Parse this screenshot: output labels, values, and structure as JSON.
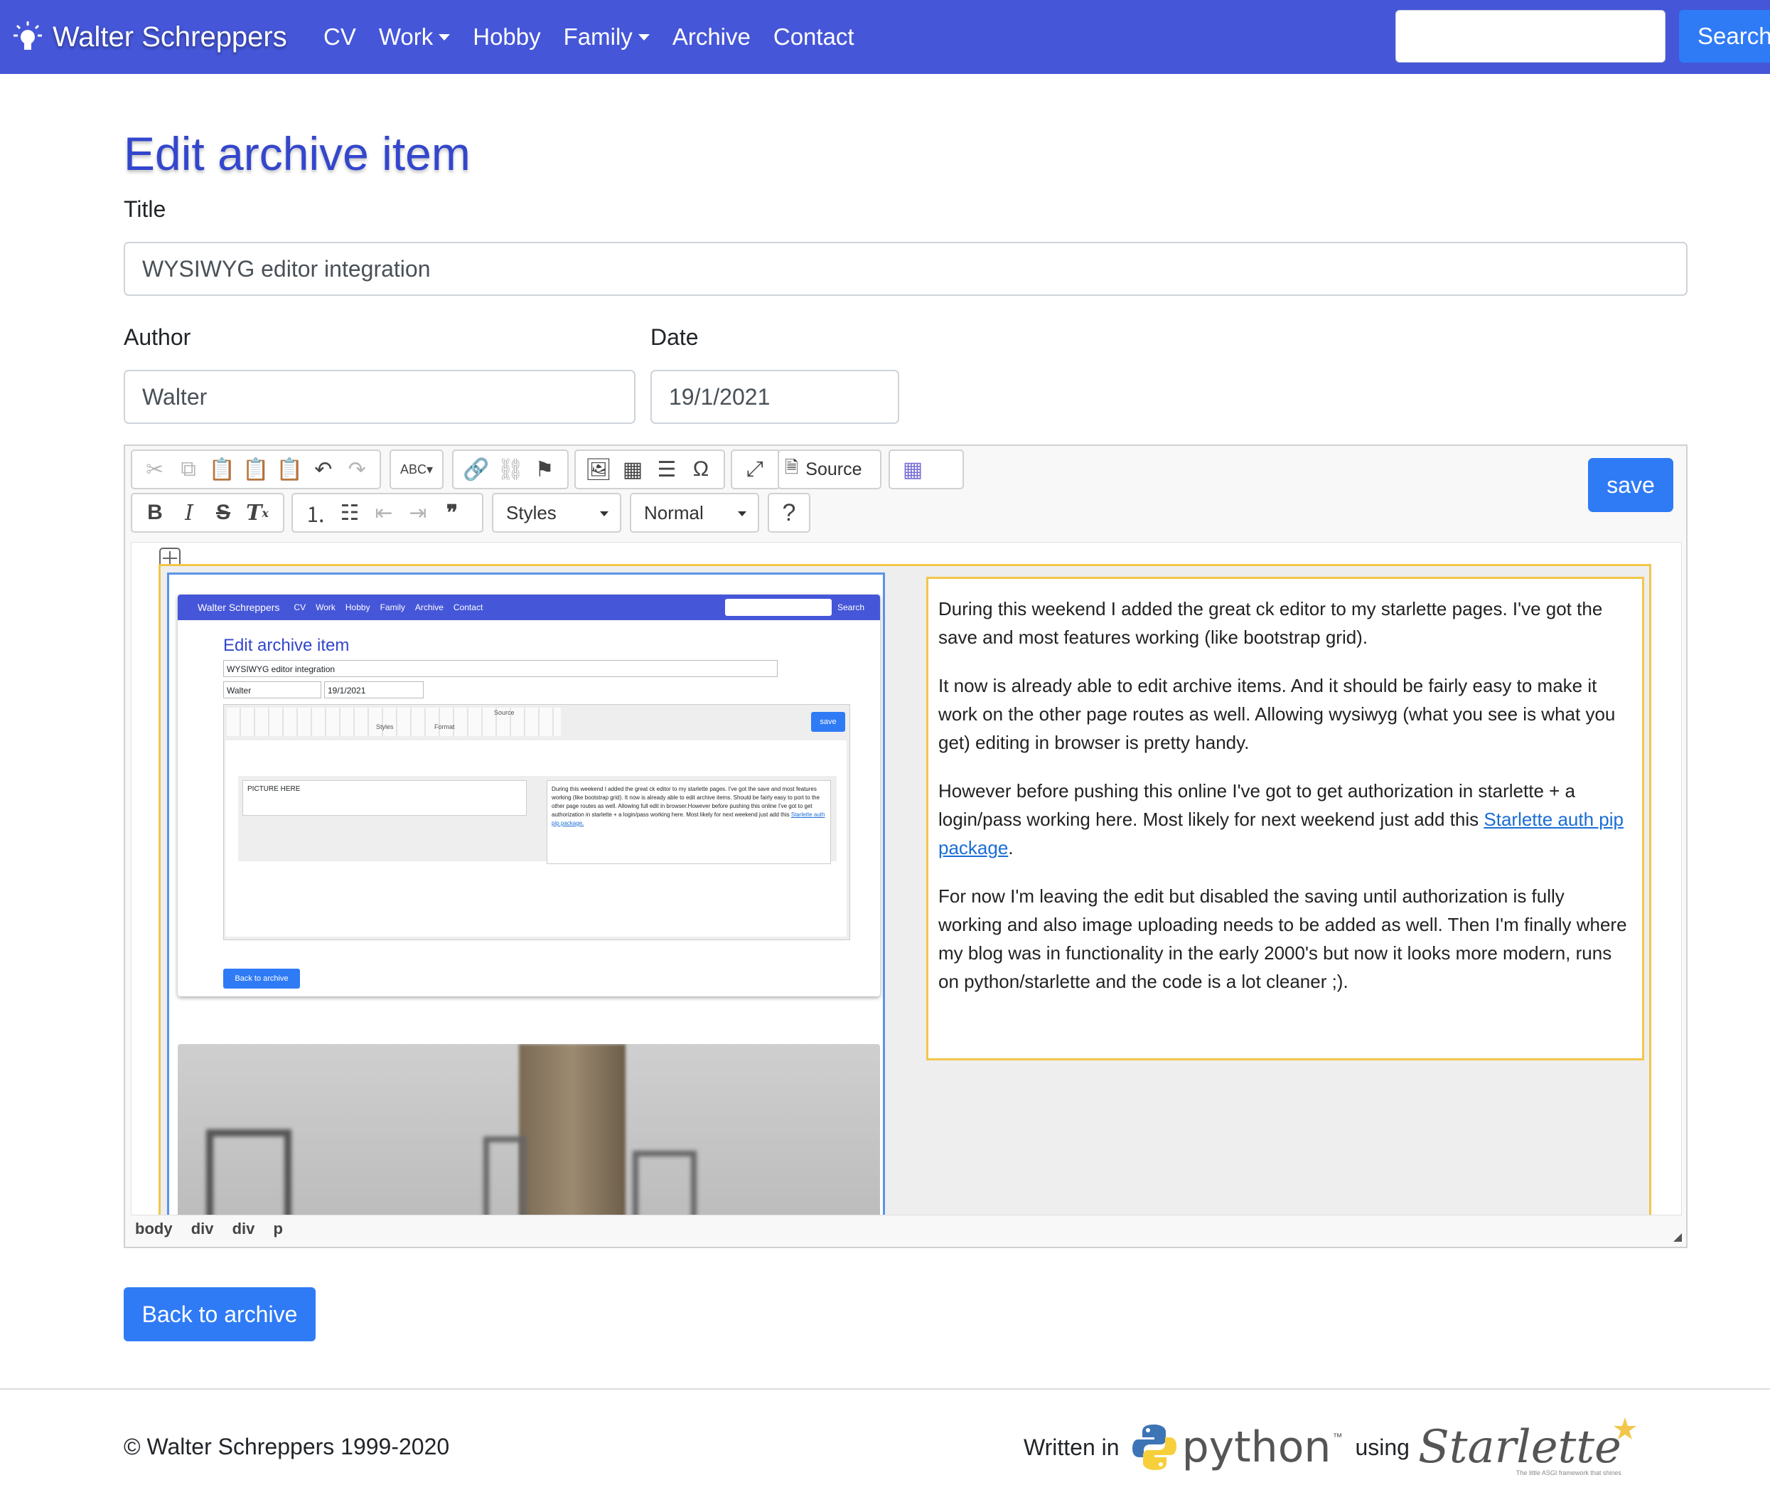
{
  "navbar": {
    "brand": "Walter Schreppers",
    "links": [
      {
        "label": "CV",
        "dropdown": false
      },
      {
        "label": "Work",
        "dropdown": true
      },
      {
        "label": "Hobby",
        "dropdown": false
      },
      {
        "label": "Family",
        "dropdown": true
      },
      {
        "label": "Archive",
        "dropdown": false
      },
      {
        "label": "Contact",
        "dropdown": false
      }
    ],
    "search_value": "",
    "search_button": "Search",
    "color": "#4556d8"
  },
  "page_title": "Edit archive item",
  "form": {
    "title_label": "Title",
    "title_value": "WYSIWYG editor integration",
    "author_label": "Author",
    "author_value": "Walter",
    "date_label": "Date",
    "date_value": "19/1/2021"
  },
  "toolbar": {
    "source_label": "Source",
    "styles_combo": "Styles",
    "format_combo": "Normal",
    "help": "?",
    "bold": "B",
    "italic": "I",
    "strike": "S",
    "remove_format": "T",
    "spell": "ABC",
    "quote": "❞",
    "omega": "Ω",
    "save_label": "save"
  },
  "editor_content": {
    "paragraphs": [
      {
        "text": "During this weekend I added the great ck editor to my starlette pages. I've got the save and most features working (like bootstrap grid)."
      },
      {
        "text": "It now is already able to edit archive items. And it should be fairly easy to make it work on the other page routes as well. Allowing wysiwyg (what you see is what you get) editing in browser is pretty handy."
      },
      {
        "text_before": "However before pushing this online I've got to get authorization in starlette + a login/pass working here. Most likely for next weekend just add this ",
        "link": "Starlette auth pip package",
        "text_after": "."
      },
      {
        "text": "For now I'm leaving the edit but disabled the saving until authorization is fully working and also image uploading needs to be added as well. Then I'm finally where my blog was in functionality in the early 2000's but now it looks more modern, runs on python/starlette and the code is a lot cleaner ;)."
      }
    ]
  },
  "embedded_screenshot": {
    "brand": "Walter Schreppers",
    "links": [
      "CV",
      "Work",
      "Hobby",
      "Family",
      "Archive",
      "Contact"
    ],
    "search": "Search",
    "title": "Edit archive item",
    "title_value": "WYSIWYG editor integration",
    "author_value": "Walter",
    "date_value": "19/1/2021",
    "save": "save",
    "source": "Source",
    "styles": "Styles",
    "format": "Format",
    "picture_placeholder": "PICTURE HERE",
    "text": "During this weekend I added the great ck editor to my starlette pages. I've got the save and most features working (like bootstrap grid). It now is already able to edit archive items. Should be fairly easy to port to the other page routes as well. Allowing full edit in browser.However before pushing this online I've got to get authorization in starlette + a login/pass working here. Most likely for next weekend just add this",
    "link": "Starlette auth pip package.",
    "back": "Back to archive"
  },
  "element_path": [
    "body",
    "div",
    "div",
    "p"
  ],
  "back_button": "Back to archive",
  "footer": {
    "copyright": "© Walter Schreppers 1999-2020",
    "written_in": "Written in",
    "python": "python",
    "tm": "™",
    "using": "using",
    "starlette": "Starlette",
    "starlette_tagline": "The little ASGI framework that shines"
  },
  "colors": {
    "primary": "#2f7bf6",
    "heading": "#3346cc",
    "nav": "#4556d8"
  }
}
